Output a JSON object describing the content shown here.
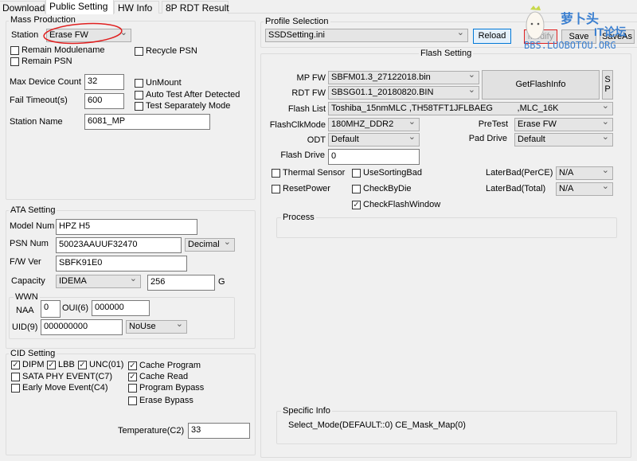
{
  "tabs": [
    "Download",
    "Public Setting",
    "HW Info",
    "8P RDT Result"
  ],
  "mass": {
    "title": "Mass Production",
    "station_label": "Station",
    "station": "Erase FW",
    "remain_modulename": "Remain Modulename",
    "remain_psn": "Remain PSN",
    "recycle_psn": "Recycle PSN",
    "max_device_label": "Max Device Count",
    "max_device": "32",
    "fail_timeout_label": "Fail Timeout(s)",
    "fail_timeout": "600",
    "unmount": "UnMount",
    "auto_test": "Auto Test After Detected",
    "test_sep": "Test Separately Mode",
    "station_name_label": "Station Name",
    "station_name": "6081_MP"
  },
  "ata": {
    "title": "ATA Setting",
    "model_label": "Model Num",
    "model": "HPZ H5",
    "psn_label": "PSN Num",
    "psn": "50023AAUUF32470",
    "psn_format": "Decimal",
    "fw_label": "F/W Ver",
    "fw": "SBFK91E0",
    "capacity_label": "Capacity",
    "capacity_mode": "IDEMA",
    "capacity": "256",
    "capacity_unit": "G",
    "wwn": {
      "title": "WWN",
      "naa_label": "NAA",
      "naa": "0",
      "oui_label": "OUI(6)",
      "oui": "000000",
      "uid_label": "UID(9)",
      "uid": "000000000",
      "uid_mode": "NoUse"
    }
  },
  "cid": {
    "title": "CID Setting",
    "dipm": "DIPM",
    "lbb": "LBB",
    "unc": "UNC(01)",
    "sata_phy": "SATA PHY EVENT(C7)",
    "early_move": "Early Move Event(C4)",
    "cache_program": "Cache Program",
    "cache_read": "Cache Read",
    "program_bypass": "Program Bypass",
    "erase_bypass": "Erase Bypass",
    "temp_label": "Temperature(C2)",
    "temp": "33"
  },
  "profile": {
    "title": "Profile Selection",
    "file": "SSDSetting.ini",
    "reload": "Reload",
    "modify": "Modify",
    "save": "Save",
    "save_as": "SaveAs"
  },
  "flash": {
    "title": "Flash Setting",
    "mpfw_label": "MP FW",
    "mpfw": "SBFM01.3_27122018.bin",
    "rdtfw_label": "RDT FW",
    "rdtfw": "SBSG01.1_20180820.BIN",
    "getinfo": "GetFlashInfo",
    "sp": "S\nP",
    "list_label": "Flash List",
    "list": "Toshiba_15nmMLC ,TH58TFT1JFLBAEG          ,MLC_16K",
    "clk_label": "FlashClkMode",
    "clk": "180MHZ_DDR2",
    "pretest_label": "PreTest",
    "pretest": "Erase FW",
    "odt_label": "ODT",
    "odt": "Default",
    "pad_label": "Pad Drive",
    "pad": "Default",
    "drive_label": "Flash Drive",
    "drive": "0",
    "thermal": "Thermal Sensor",
    "sorting": "UseSortingBad",
    "reset": "ResetPower",
    "bydie": "CheckByDie",
    "window": "CheckFlashWindow",
    "latebad_ce_label": "LaterBad(PerCE)",
    "latebad_ce": "N/A",
    "latebad_total_label": "LaterBad(Total)",
    "latebad_total": "N/A",
    "process_title": "Process",
    "specific_title": "Specific Info",
    "specific": "Select_Mode(DEFAULT::0) CE_Mask_Map(0)"
  },
  "watermark": {
    "cn": "萝卜头",
    "it": "IT论坛",
    "url": "BBS.LUOBOTOU.ORG"
  },
  "colors": {
    "annotation": "#e02020",
    "watermark": "#3a7fd0"
  }
}
